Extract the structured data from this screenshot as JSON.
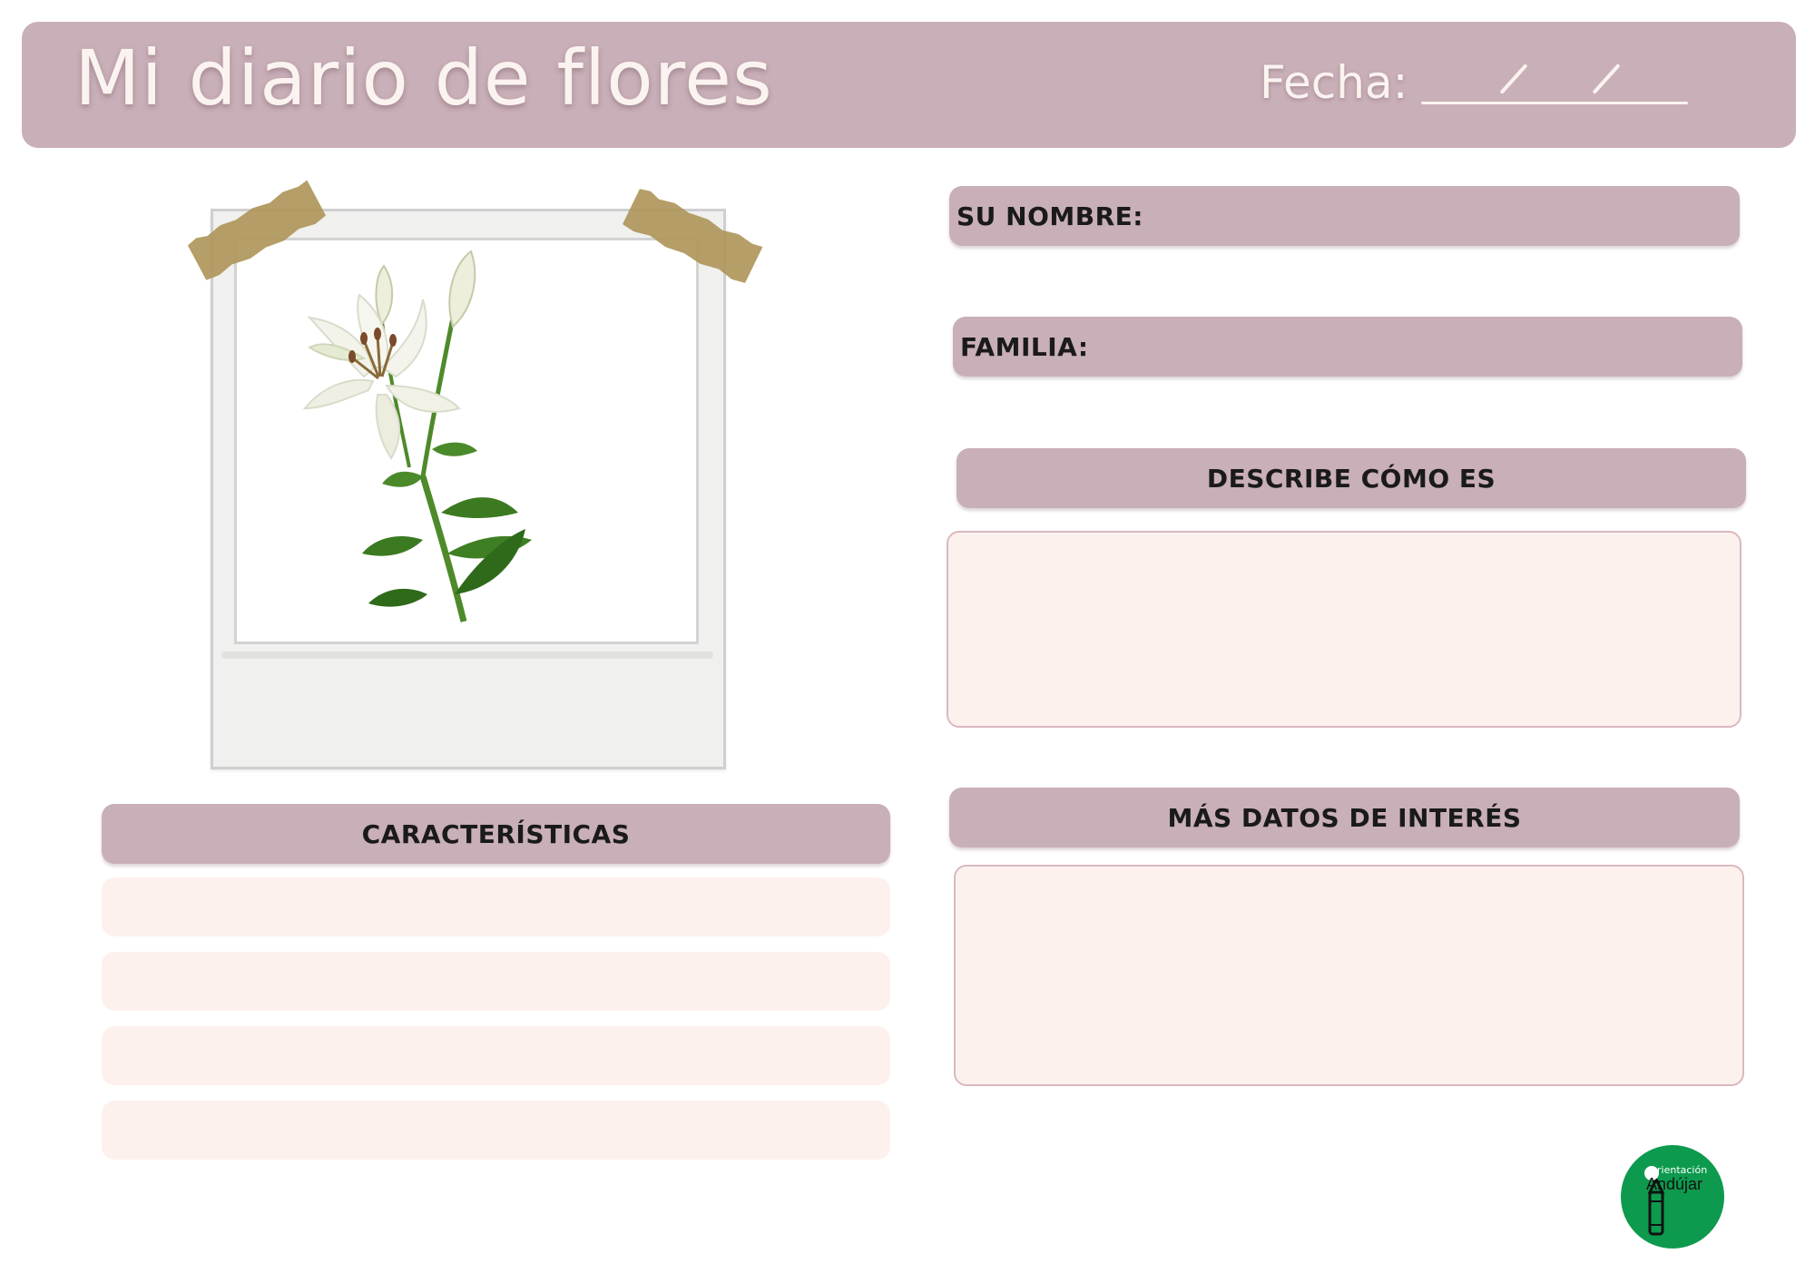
{
  "header": {
    "title": "Mi diario de flores",
    "date_label": "Fecha:"
  },
  "photo": {
    "subject": "white-lily"
  },
  "fields": {
    "name_label": "SU NOMBRE:",
    "family_label": "FAMILIA:"
  },
  "sections": {
    "describe_label": "DESCRIBE CÓMO ES",
    "characteristics_label": "CARACTERÍSTICAS",
    "more_data_label": "MÁS DATOS DE INTERÉS"
  },
  "logo": {
    "line1": "rientación",
    "line2": "Andújar"
  },
  "colors": {
    "mauve": "#c9afb8",
    "blush": "#fdf1ee",
    "logo_green": "#0d9a4e"
  }
}
